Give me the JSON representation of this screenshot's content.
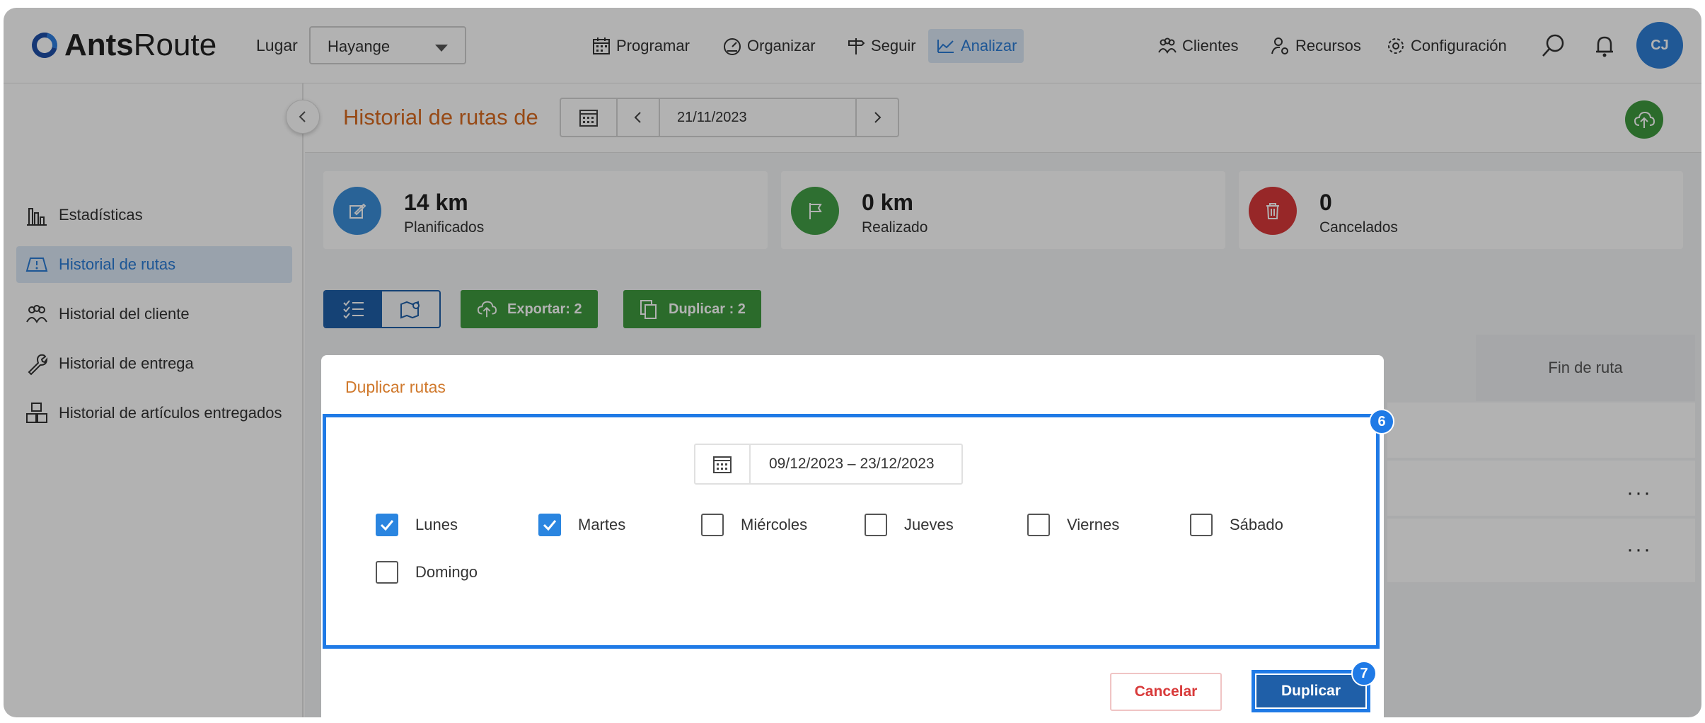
{
  "brand": {
    "name_bold": "Ants",
    "name_rest": "Route"
  },
  "topnav": {
    "lugar_label": "Lugar",
    "lugar_value": "Hayange",
    "items": [
      {
        "label": "Programar",
        "icon": "calendar-icon"
      },
      {
        "label": "Organizar",
        "icon": "speedometer-icon"
      },
      {
        "label": "Seguir",
        "icon": "signpost-icon"
      },
      {
        "label": "Analizar",
        "icon": "chart-icon",
        "active": true
      },
      {
        "label": "Clientes",
        "icon": "users-icon"
      },
      {
        "label": "Recursos",
        "icon": "user-gear-icon"
      },
      {
        "label": "Configuración",
        "icon": "gear-icon"
      }
    ],
    "avatar": "CJ"
  },
  "sidebar": {
    "items": [
      {
        "label": "Estadísticas",
        "icon": "bar-chart-icon"
      },
      {
        "label": "Historial de rutas",
        "icon": "route-map-icon",
        "active": true
      },
      {
        "label": "Historial del cliente",
        "icon": "users-icon"
      },
      {
        "label": "Historial de entrega",
        "icon": "wrench-icon"
      },
      {
        "label": "Historial de artículos entregados",
        "icon": "boxes-icon"
      }
    ]
  },
  "main": {
    "title": "Historial de rutas de",
    "date": "21/11/2023",
    "stats": [
      {
        "value": "14 km",
        "label": "Planificados",
        "color": "#3b8fd9",
        "icon": "edit-icon"
      },
      {
        "value": "0 km",
        "label": "Realizado",
        "color": "#43a047",
        "icon": "flag-icon"
      },
      {
        "value": "0",
        "label": "Cancelados",
        "color": "#d9383a",
        "icon": "trash-icon"
      }
    ],
    "export_label": "Exportar: 2",
    "duplicate_label": "Duplicar : 2",
    "column_end": "Fin de ruta"
  },
  "modal": {
    "title": "Duplicar rutas",
    "range": "09/12/2023 – 23/12/2023",
    "days": [
      {
        "label": "Lunes",
        "checked": true
      },
      {
        "label": "Martes",
        "checked": true
      },
      {
        "label": "Miércoles",
        "checked": false
      },
      {
        "label": "Jueves",
        "checked": false
      },
      {
        "label": "Viernes",
        "checked": false
      },
      {
        "label": "Sábado",
        "checked": false
      },
      {
        "label": "Domingo",
        "checked": false
      }
    ],
    "cancel_label": "Cancelar",
    "confirm_label": "Duplicar",
    "step_body": "6",
    "step_confirm": "7"
  },
  "colors": {
    "accent": "#1f7ae6",
    "brand_blue": "#1f5fa8",
    "green": "#3e9a3e",
    "title_orange": "#d86a20"
  }
}
